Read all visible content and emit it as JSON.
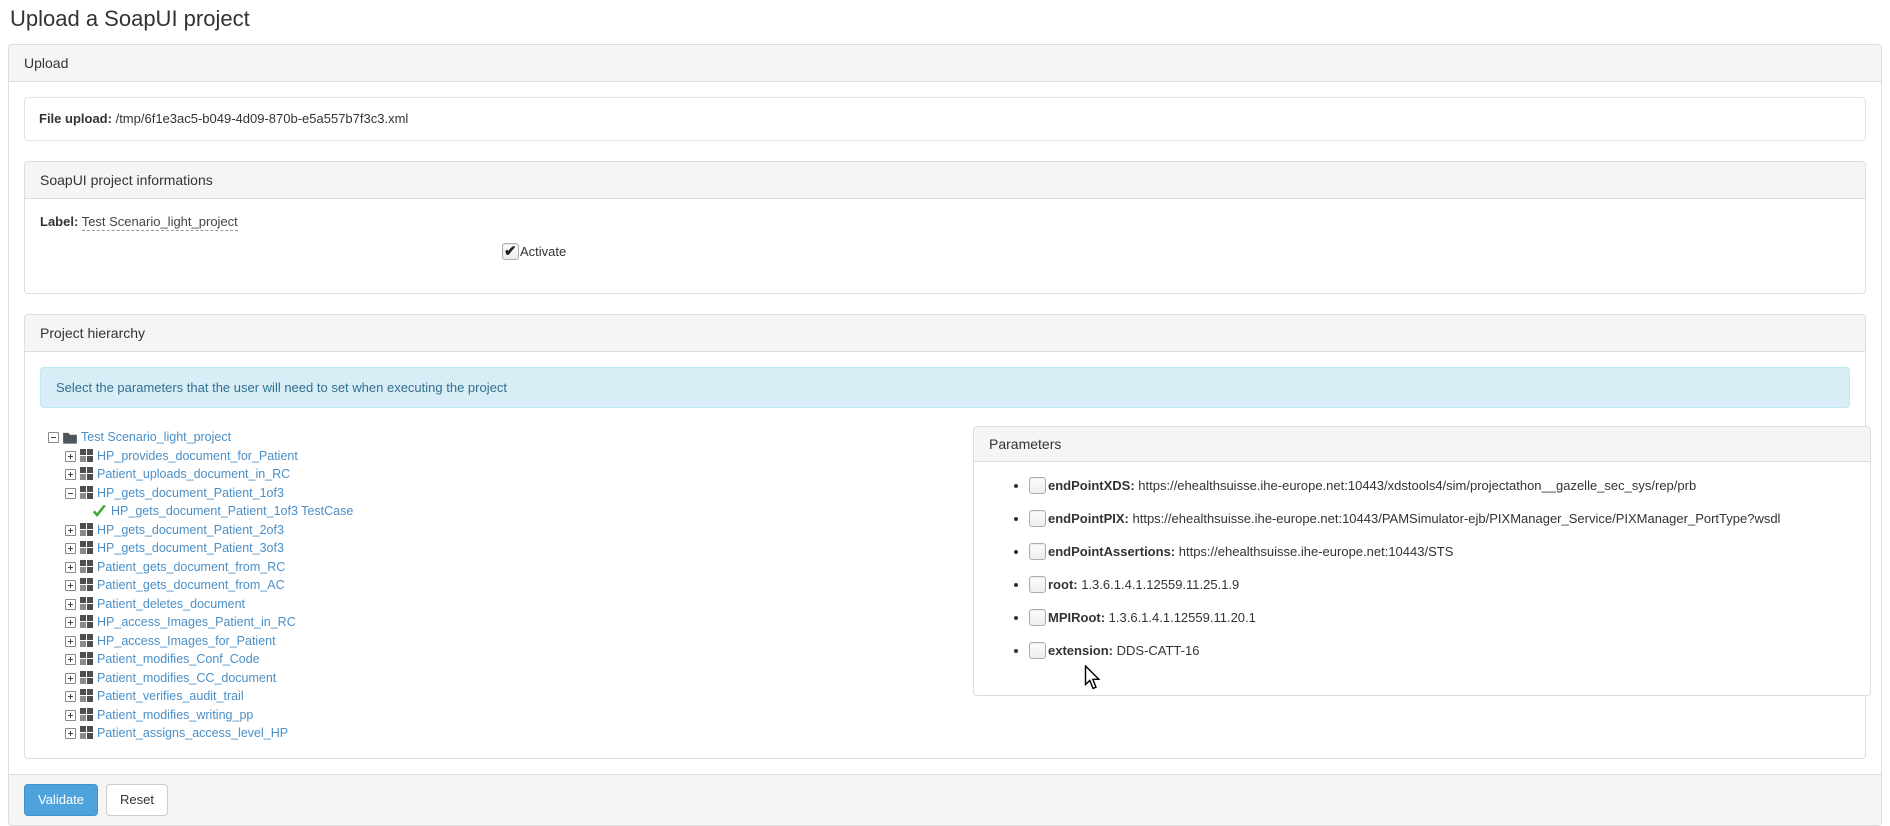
{
  "page": {
    "title": "Upload a SoapUI project"
  },
  "upload_panel": {
    "heading": "Upload",
    "file_upload_label": "File upload:",
    "file_path": "/tmp/6f1e3ac5-b049-4d09-870b-e5a557b7f3c3.xml"
  },
  "info_panel": {
    "heading": "SoapUI project informations",
    "label_caption": "Label:",
    "label_value": "Test Scenario_light_project",
    "activate_label": "Activate",
    "activate_checked": true
  },
  "hierarchy_panel": {
    "heading": "Project hierarchy",
    "alert": "Select the parameters that the user will need to set when executing the project",
    "tree": [
      {
        "label": "Test Scenario_light_project",
        "level": 0,
        "toggle": "minus",
        "icon": "folder"
      },
      {
        "label": "HP_provides_document_for_Patient",
        "level": 1,
        "toggle": "plus",
        "icon": "suite"
      },
      {
        "label": "Patient_uploads_document_in_RC",
        "level": 1,
        "toggle": "plus",
        "icon": "suite"
      },
      {
        "label": "HP_gets_document_Patient_1of3",
        "level": 1,
        "toggle": "minus",
        "icon": "suite"
      },
      {
        "label": "HP_gets_document_Patient_1of3 TestCase",
        "level": 2,
        "toggle": "none",
        "icon": "check"
      },
      {
        "label": "HP_gets_document_Patient_2of3",
        "level": 1,
        "toggle": "plus",
        "icon": "suite"
      },
      {
        "label": "HP_gets_document_Patient_3of3",
        "level": 1,
        "toggle": "plus",
        "icon": "suite"
      },
      {
        "label": "Patient_gets_document_from_RC",
        "level": 1,
        "toggle": "plus",
        "icon": "suite"
      },
      {
        "label": "Patient_gets_document_from_AC",
        "level": 1,
        "toggle": "plus",
        "icon": "suite"
      },
      {
        "label": "Patient_deletes_document",
        "level": 1,
        "toggle": "plus",
        "icon": "suite"
      },
      {
        "label": "HP_access_Images_Patient_in_RC",
        "level": 1,
        "toggle": "plus",
        "icon": "suite"
      },
      {
        "label": "HP_access_Images_for_Patient",
        "level": 1,
        "toggle": "plus",
        "icon": "suite"
      },
      {
        "label": "Patient_modifies_Conf_Code",
        "level": 1,
        "toggle": "plus",
        "icon": "suite"
      },
      {
        "label": "Patient_modifies_CC_document",
        "level": 1,
        "toggle": "plus",
        "icon": "suite"
      },
      {
        "label": "Patient_verifies_audit_trail",
        "level": 1,
        "toggle": "plus",
        "icon": "suite"
      },
      {
        "label": "Patient_modifies_writing_pp",
        "level": 1,
        "toggle": "plus",
        "icon": "suite"
      },
      {
        "label": "Patient_assigns_access_level_HP",
        "level": 1,
        "toggle": "plus",
        "icon": "suite"
      }
    ]
  },
  "parameters_panel": {
    "heading": "Parameters",
    "items": [
      {
        "name": "endPointXDS:",
        "value": "https://ehealthsuisse.ihe-europe.net:10443/xdstools4/sim/projectathon__gazelle_sec_sys/rep/prb",
        "checked": false
      },
      {
        "name": "endPointPIX:",
        "value": "https://ehealthsuisse.ihe-europe.net:10443/PAMSimulator-ejb/PIXManager_Service/PIXManager_PortType?wsdl",
        "checked": false
      },
      {
        "name": "endPointAssertions:",
        "value": "https://ehealthsuisse.ihe-europe.net:10443/STS",
        "checked": false
      },
      {
        "name": "root:",
        "value": "1.3.6.1.4.1.12559.11.25.1.9",
        "checked": false
      },
      {
        "name": "MPIRoot:",
        "value": "1.3.6.1.4.1.12559.11.20.1",
        "checked": false
      },
      {
        "name": "extension:",
        "value": "DDS-CATT-16",
        "checked": false
      }
    ]
  },
  "footer": {
    "validate_label": "Validate",
    "reset_label": "Reset"
  },
  "colors": {
    "validate_button": "#4fa3dc",
    "tree_link": "#4a8fc7",
    "alert_background": "#d9edf7",
    "alert_text": "#31708f",
    "check_green": "#3fa535",
    "panel_heading_background": "#f5f5f5"
  }
}
